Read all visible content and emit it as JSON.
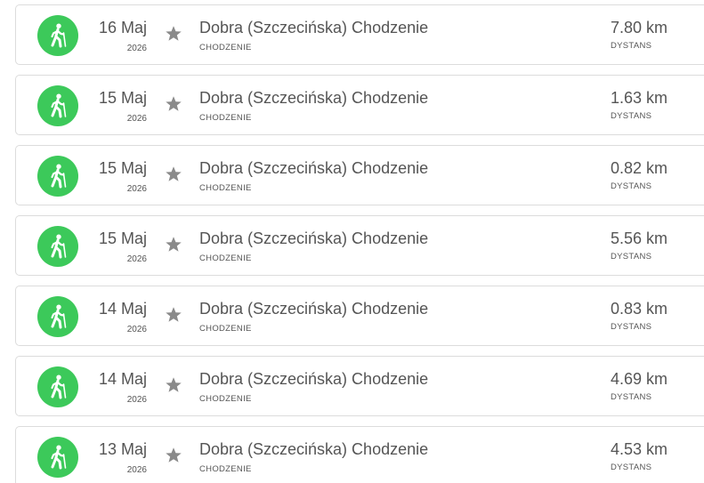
{
  "accent_color": "#3cc95a",
  "activities": [
    {
      "icon": "walking-person-icon",
      "day": "16 Maj",
      "year": "2026",
      "title": "Dobra (Szczecińska) Chodzenie",
      "type": "CHODZENIE",
      "distance": "7.80 km",
      "distance_label": "DYSTANS"
    },
    {
      "icon": "walking-person-icon",
      "day": "15 Maj",
      "year": "2026",
      "title": "Dobra (Szczecińska) Chodzenie",
      "type": "CHODZENIE",
      "distance": "1.63 km",
      "distance_label": "DYSTANS"
    },
    {
      "icon": "walking-person-icon",
      "day": "15 Maj",
      "year": "2026",
      "title": "Dobra (Szczecińska) Chodzenie",
      "type": "CHODZENIE",
      "distance": "0.82 km",
      "distance_label": "DYSTANS"
    },
    {
      "icon": "walking-person-icon",
      "day": "15 Maj",
      "year": "2026",
      "title": "Dobra (Szczecińska) Chodzenie",
      "type": "CHODZENIE",
      "distance": "5.56 km",
      "distance_label": "DYSTANS"
    },
    {
      "icon": "walking-person-icon",
      "day": "14 Maj",
      "year": "2026",
      "title": "Dobra (Szczecińska) Chodzenie",
      "type": "CHODZENIE",
      "distance": "0.83 km",
      "distance_label": "DYSTANS"
    },
    {
      "icon": "walking-person-icon",
      "day": "14 Maj",
      "year": "2026",
      "title": "Dobra (Szczecińska) Chodzenie",
      "type": "CHODZENIE",
      "distance": "4.69 km",
      "distance_label": "DYSTANS"
    },
    {
      "icon": "walking-person-icon",
      "day": "13 Maj",
      "year": "2026",
      "title": "Dobra (Szczecińska) Chodzenie",
      "type": "CHODZENIE",
      "distance": "4.53 km",
      "distance_label": "DYSTANS"
    }
  ]
}
